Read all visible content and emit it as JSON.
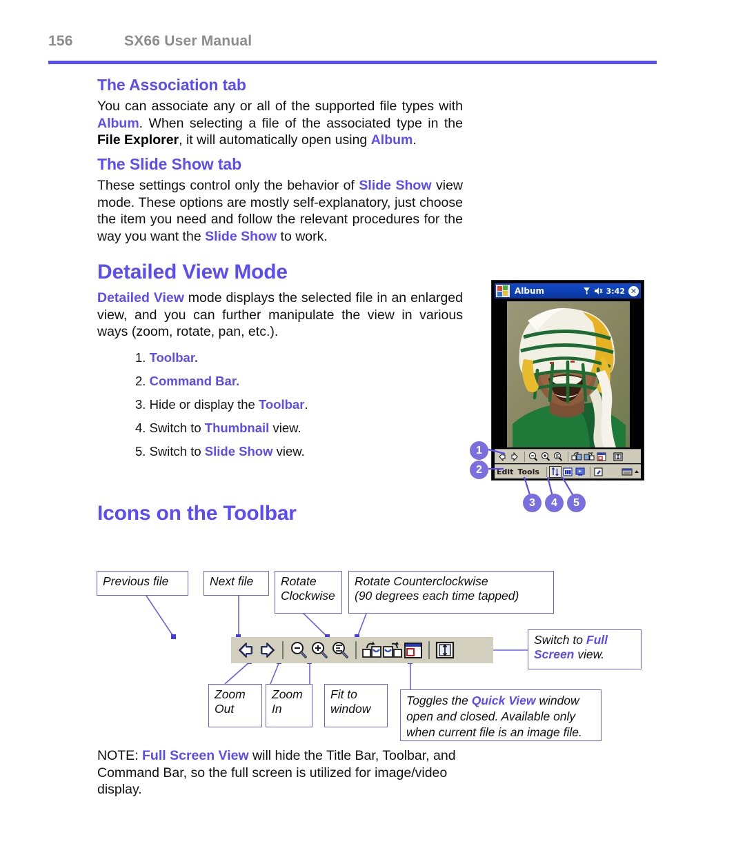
{
  "header": {
    "page_number": "156",
    "manual_title": "SX66 User Manual",
    "rule_color": "#5b4df5"
  },
  "accent_color": "#5b4df5",
  "sections": {
    "association": {
      "heading": "The Association tab",
      "line1_a": "You can associate any or all of the supported file types with ",
      "album1": "Album",
      "line1_b": ". When selecting a file of the associated type in the ",
      "file_explorer": "File Explorer",
      "line1_c": ", it will automatically open using ",
      "album2": "Album",
      "line1_d": "."
    },
    "slide_show": {
      "heading": "The Slide Show tab",
      "text_a": "These settings control only the behavior of ",
      "kw1": "Slide Show",
      "text_b": " view mode. These options are mostly self-explanatory, just choose the item you need and follow the relevant procedures for the way you want the ",
      "kw2": "Slide Show",
      "text_c": " to work."
    },
    "detailed_view": {
      "heading": "Detailed View Mode",
      "kw1": "Detailed View",
      "text_a": " mode displays the selected file in an enlarged view, and you can further manipulate the view in various ways (zoom, rotate, pan, etc.)."
    },
    "icons_toolbar": {
      "heading": "Icons on the Toolbar"
    },
    "note": {
      "prefix": "NOTE: ",
      "kw": "Full Screen View",
      "text": " will hide the Title Bar, Toolbar, and Command Bar, so the full screen is utilized for image/video display."
    }
  },
  "numbered_list": [
    {
      "num": "1.",
      "kw": "Toolbar.",
      "pre": "",
      "post": ""
    },
    {
      "num": "2.",
      "kw": "Command Bar.",
      "pre": "",
      "post": ""
    },
    {
      "num": "3.",
      "kw": "Toolbar",
      "pre": "Hide or display the ",
      "post": "."
    },
    {
      "num": "4.",
      "kw": "Thumbnail",
      "pre": "Switch to ",
      "post": " view."
    },
    {
      "num": "5.",
      "kw": "Slide Show",
      "pre": "Switch to ",
      "post": " view."
    }
  ],
  "pda": {
    "app_title": "Album",
    "tray_signal": "signal-icon",
    "tray_volume": "volume-icon",
    "tray_time": "3:42",
    "close_label": "✕",
    "toolbar_icons": [
      "previous-file-icon",
      "next-file-icon",
      "zoom-out-icon",
      "zoom-in-icon",
      "fit-to-window-icon",
      "rotate-clockwise-icon",
      "rotate-counterclockwise-icon",
      "quick-view-icon",
      "full-screen-icon"
    ],
    "cmdbar_edit": "Edit",
    "cmdbar_tools": "Tools",
    "cmdbar_icons": [
      "toggle-toolbar-icon",
      "thumbnail-view-icon",
      "slide-show-icon",
      "annotate-icon",
      "keyboard-icon",
      "chevron-up-icon"
    ],
    "callouts": [
      "1",
      "2",
      "3",
      "4",
      "5"
    ]
  },
  "diagram": {
    "boxes": {
      "previous_file": "Previous file",
      "next_file": "Next file",
      "rotate_clockwise_l1": "Rotate",
      "rotate_clockwise_l2": "Clockwise",
      "rotate_ccw_l1": "Rotate Counterclockwise",
      "rotate_ccw_l2": "(90 degrees each time tapped)",
      "switch_full_a": "Switch to ",
      "switch_full_kw1": "Full",
      "switch_full_kw2": "Screen",
      "switch_full_b": " view.",
      "zoom_out_l1": "Zoom",
      "zoom_out_l2": "Out",
      "zoom_in_l1": "Zoom",
      "zoom_in_l2": "In",
      "fit_window_l1": "Fit to",
      "fit_window_l2": "window",
      "quick_view_a": "Toggles the ",
      "quick_view_kw": "Quick View",
      "quick_view_b": " window open and closed. Available only when current file is an image file."
    },
    "strip_background": "#d2cfbf",
    "toolbar_icons": [
      "previous-file-icon",
      "next-file-icon",
      "zoom-out-icon",
      "zoom-in-icon",
      "fit-to-window-icon",
      "rotate-clockwise-icon",
      "rotate-counterclockwise-icon",
      "quick-view-icon",
      "full-screen-icon"
    ]
  }
}
